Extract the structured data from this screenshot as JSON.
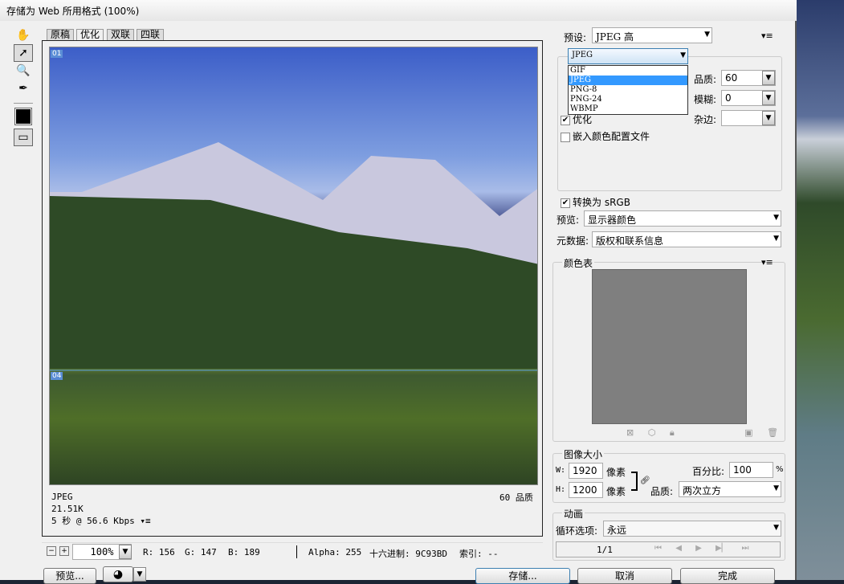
{
  "title": "存储为 Web 所用格式 (100%)",
  "tabs": [
    "原稿",
    "优化",
    "双联",
    "四联"
  ],
  "active_tab": "优化",
  "slices": [
    "01",
    "04"
  ],
  "image_info": {
    "format": "JPEG",
    "size": "21.51K",
    "time": "5 秒 @ 56.6 Kbps",
    "quality": "60 品质"
  },
  "status": {
    "zoom": "100%",
    "r": "R: 156",
    "g": "G: 147",
    "b": "B: 189",
    "alpha": "Alpha: 255",
    "hex": "十六进制: 9C93BD",
    "index": "索引: --"
  },
  "buttons": {
    "preview": "预览...",
    "save": "存储...",
    "cancel": "取消",
    "done": "完成"
  },
  "settings": {
    "preset_label": "预设:",
    "preset": "JPEG 高",
    "format": "JPEG",
    "format_options": [
      "GIF",
      "JPEG",
      "PNG-8",
      "PNG-24",
      "WBMP"
    ],
    "selected_format": "JPEG",
    "quality_label": "品质:",
    "quality": "60",
    "blur_label": "模糊:",
    "blur": "0",
    "matte_label": "杂边:",
    "matte": "",
    "optimize": "优化",
    "embed_profile": "嵌入颜色配置文件",
    "convert_srgb": "转换为 sRGB",
    "preview_label": "预览:",
    "preview_value": "显示器颜色",
    "metadata_label": "元数据:",
    "metadata_value": "版权和联系信息"
  },
  "color_table": {
    "title": "颜色表"
  },
  "image_size": {
    "title": "图像大小",
    "w_label": "W:",
    "w": "1920",
    "h_label": "H:",
    "h": "1200",
    "unit": "像素",
    "percent_label": "百分比:",
    "percent": "100",
    "percent_unit": "%",
    "quality_label": "品质:",
    "quality": "两次立方"
  },
  "animation": {
    "title": "动画",
    "loop_label": "循环选项:",
    "loop": "永远",
    "frame": "1/1"
  }
}
